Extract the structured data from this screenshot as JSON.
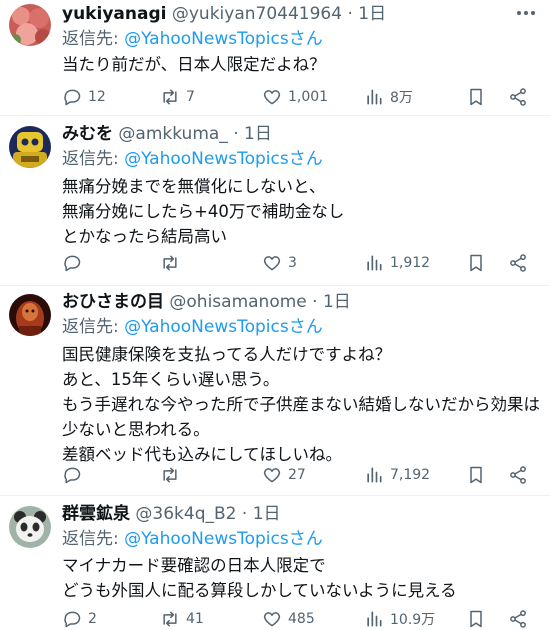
{
  "tweets": [
    {
      "name": "yukiyanagi",
      "handle": "@yukiyan70441964",
      "time": "1日",
      "reply_prefix": "返信先: ",
      "reply_to": "@YahooNewsTopicsさん",
      "text": "当たり前だが、日本人限定だよね？",
      "replies": "12",
      "retweets": "7",
      "likes": "1,001",
      "views": "8万",
      "avatar": "pink-flowers"
    },
    {
      "name": "みむを",
      "handle": "@amkkuma_",
      "time": "1日",
      "reply_prefix": "返信先: ",
      "reply_to": "@YahooNewsTopicsさん",
      "text": "無痛分娩までを無償化にしないと、\n無痛分娩にしたら+40万で補助金なし\nとかなったら結局高い",
      "replies": "",
      "retweets": "",
      "likes": "3",
      "views": "1,912",
      "avatar": "yellow-robot"
    },
    {
      "name": "おひさまの目",
      "handle": "@ohisamanome",
      "time": "1日",
      "reply_prefix": "返信先: ",
      "reply_to": "@YahooNewsTopicsさん",
      "text": "国民健康保険を支払ってる人だけですよね？\nあと、15年くらい遅い思う。\nもう手遅れな今やった所で子供産まない結婚しないだから効果は少ないと思われる。\n差額ベッド代も込みにしてほしいね。",
      "replies": "",
      "retweets": "",
      "likes": "27",
      "views": "7,192",
      "avatar": "red-statue"
    },
    {
      "name": "群雲鉱泉",
      "handle": "@36k4q_B2",
      "time": "1日",
      "reply_prefix": "返信先: ",
      "reply_to": "@YahooNewsTopicsさん",
      "text": "マイナカード要確認の日本人限定で\nどうも外国人に配る算段しかしていないように見える",
      "replies": "2",
      "retweets": "41",
      "likes": "485",
      "views": "10.9万",
      "avatar": "panda"
    }
  ],
  "colors": {
    "link": "#1d9bf0",
    "muted": "#536471",
    "text": "#0f1419",
    "divider": "#eff3f4"
  }
}
